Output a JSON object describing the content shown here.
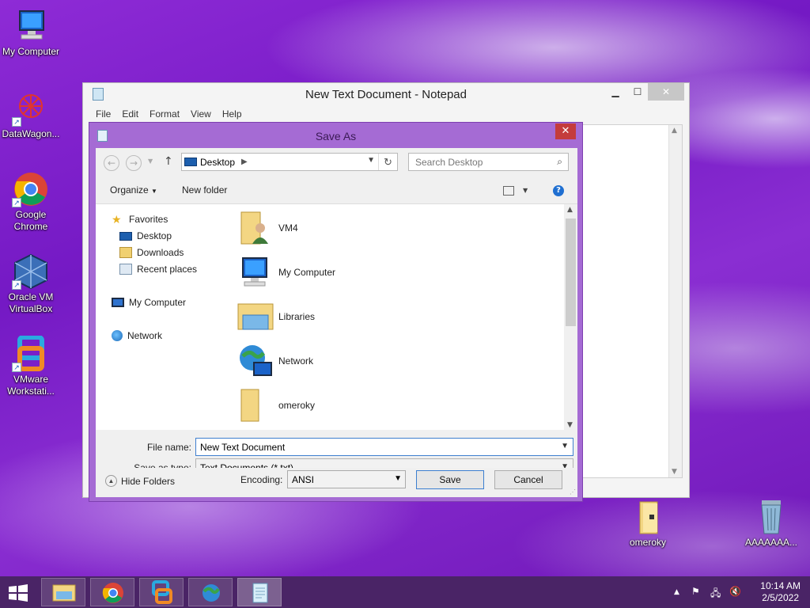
{
  "desktop": {
    "icons": [
      {
        "label": "My Computer"
      },
      {
        "label": "DataWagon..."
      },
      {
        "label": "Google Chrome"
      },
      {
        "label": "Oracle VM VirtualBox"
      },
      {
        "label": "VMware Workstati..."
      },
      {
        "label": "omeroky"
      },
      {
        "label": "AAAAAAA..."
      }
    ]
  },
  "notepad": {
    "title": "New Text Document - Notepad",
    "menu": [
      "File",
      "Edit",
      "Format",
      "View",
      "Help"
    ]
  },
  "dialog": {
    "title": "Save As",
    "address": "Desktop",
    "search_placeholder": "Search Desktop",
    "organize_label": "Organize",
    "new_folder_label": "New folder",
    "nav_tree": {
      "favorites": "Favorites",
      "desktop": "Desktop",
      "downloads": "Downloads",
      "recent": "Recent places",
      "my_computer": "My Computer",
      "network": "Network"
    },
    "files": [
      "VM4",
      "My Computer",
      "Libraries",
      "Network",
      "omeroky"
    ],
    "file_name_label": "File name:",
    "file_name_value": "New Text Document",
    "save_type_label": "Save as type:",
    "save_type_value": "Text Documents (*.txt)",
    "hide_folders_label": "Hide Folders",
    "encoding_label": "Encoding:",
    "encoding_value": "ANSI",
    "save_label": "Save",
    "cancel_label": "Cancel"
  },
  "taskbar": {
    "time": "10:14 AM",
    "date": "2/5/2022"
  },
  "colors": {
    "dialog_frame": "#a56bd4",
    "taskbar": "#4a2466",
    "close_red": "#c43c3c"
  }
}
